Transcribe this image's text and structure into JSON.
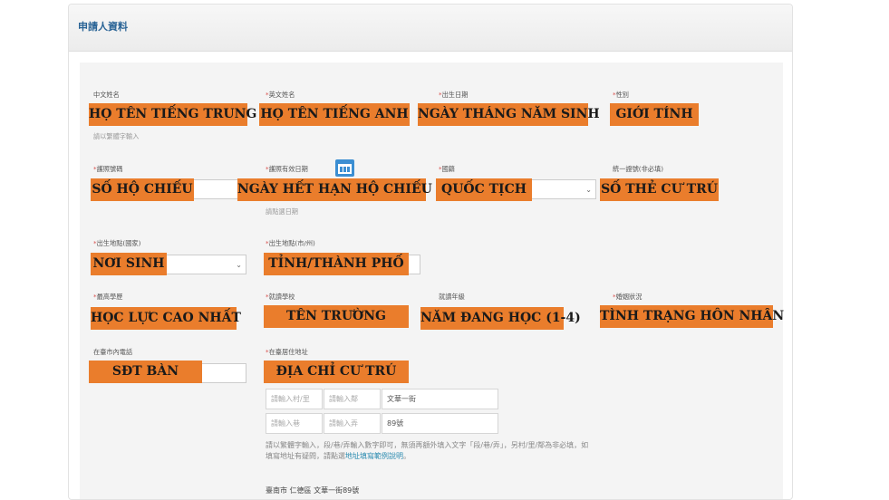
{
  "panel": {
    "title": "申請人資料"
  },
  "labels": {
    "chinese_name": "中文姓名",
    "english_name": "英文姓名",
    "birth_date": "出生日期",
    "gender": "性別",
    "passport_no": "護照號碼",
    "passport_expiry": "護照有效日期",
    "nationality": "國籍",
    "uniform_id": "統一證號(非必填)",
    "birth_country": "出生地點(國家)",
    "birth_city": "出生地點(市/州)",
    "education": "最高學歷",
    "school": "就讀學校",
    "grade": "就讀年級",
    "marital": "婚姻狀況",
    "phone": "在臺市內電話",
    "address": "在臺居住地址"
  },
  "hints": {
    "chinese_name": "請以繁體字輸入",
    "passport_expiry": "請點選日期"
  },
  "overlays": {
    "chinese_name": "HỌ TÊN TIẾNG TRUNG",
    "english_name": "HỌ TÊN TIẾNG ANH",
    "birth_date": "NGÀY THÁNG NĂM SINH",
    "gender": "GIỚI TÍNH",
    "passport_no": "SỐ HỘ CHIẾU",
    "passport_expiry": "NGÀY HẾT HẠN HỘ CHIẾU",
    "nationality": "QUỐC TỊCH",
    "uniform_id": "SỐ THẺ CƯ TRÚ",
    "birth_country": "NƠI SINH",
    "birth_city": "TỈNH/THÀNH PHỐ",
    "education": "HỌC LỰC CAO NHẤT",
    "school": "TÊN TRƯỜNG",
    "grade": "NĂM ĐANG HỌC (1-4)",
    "marital": "TÌNH TRẠNG HÔN NHÂN",
    "phone": "SĐT BÀN",
    "address": "ĐỊA CHỈ CƯ TRÚ"
  },
  "address": {
    "row1": [
      "請輸入村/里",
      "請輸入鄰",
      "文華一街"
    ],
    "row2": [
      "請輸入巷",
      "請輸入弄",
      "89號"
    ],
    "note": "請以繁體字輸入，段/巷/弄輸入數字即可，無須再額外填入文字「段/巷/弄」，另村/里/鄰為非必填，如填寫地址有疑問，請點選",
    "note_link": "地址填寫範例說明",
    "note_end": "。",
    "result": "臺南市 仁德區 文華一街89號"
  },
  "icons": {
    "calendar": "calendar-icon",
    "select_arrow": "chevron-down-icon"
  },
  "colors": {
    "overlay": "#ea7d2c",
    "title": "#2a6496",
    "required": "#d9534f"
  }
}
